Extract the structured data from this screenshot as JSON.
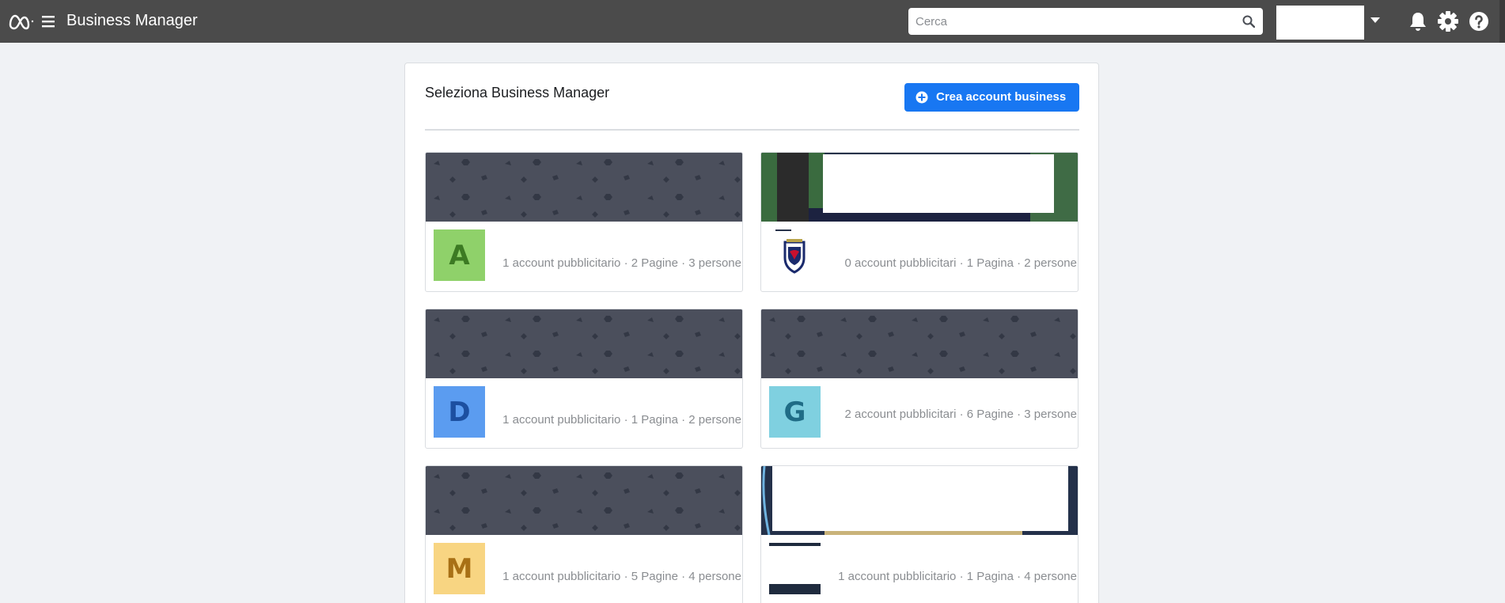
{
  "header": {
    "title": "Business Manager",
    "search_placeholder": "Cerca",
    "icons": [
      "meta-logo-icon",
      "menu-icon",
      "search-icon",
      "chevron-down-icon",
      "bell-icon",
      "gear-icon",
      "help-icon"
    ]
  },
  "panel": {
    "title": "Seleziona Business Manager",
    "create_button": "Crea account business"
  },
  "colors": {
    "topbar": "#4b4b4b",
    "accent": "#1877f2",
    "cover_pattern": "#4b4f5c",
    "text_muted": "#8a8d91"
  },
  "cards": [
    {
      "letter": "A",
      "avatar_bg": "#8fd16a",
      "avatar_fg": "#3c7a23",
      "stats": "1 account pubblicitario · 2 Pagine · 3 persone"
    },
    {
      "letter": "",
      "avatar": "club-crest-logo",
      "stats": "0 account pubblicitari · 1 Pagina · 2 persone"
    },
    {
      "letter": "D",
      "avatar_bg": "#5b9cf0",
      "avatar_fg": "#1c4fa0",
      "stats": "1 account pubblicitario · 1 Pagina · 2 persone"
    },
    {
      "letter": "G",
      "avatar_bg": "#7fd0e0",
      "avatar_fg": "#1f6c86",
      "stats": "2 account pubblicitari · 6 Pagine · 3 persone"
    },
    {
      "letter": "M",
      "avatar_bg": "#f8d582",
      "avatar_fg": "#a87015",
      "stats": "1 account pubblicitario · 5 Pagine · 4 persone"
    },
    {
      "letter": "",
      "avatar": "photo-avatar",
      "stats": "1 account pubblicitario · 1 Pagina · 4 persone"
    }
  ]
}
